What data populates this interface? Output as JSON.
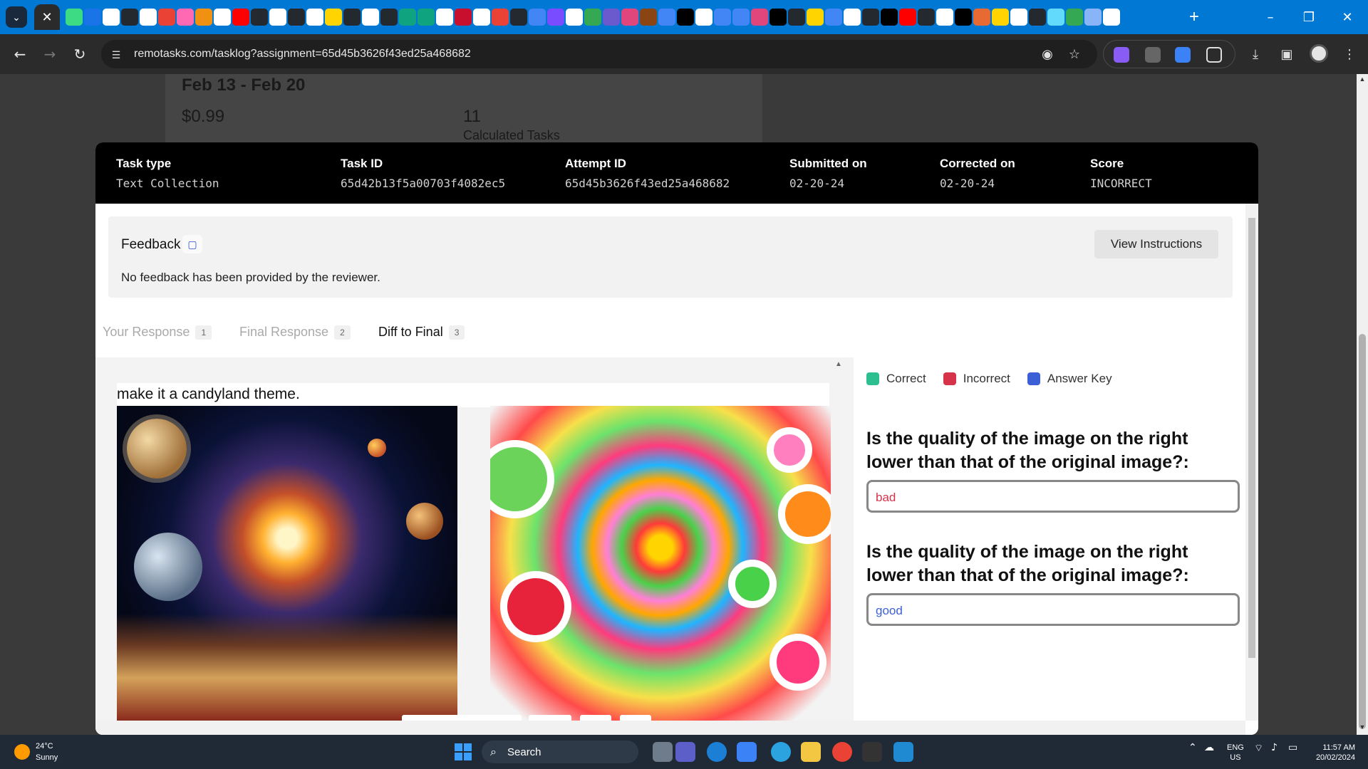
{
  "browser": {
    "tab_close_glyph": "✕",
    "tab_menu_glyph": "⌄",
    "new_tab_glyph": "+",
    "url": "remotasks.com/tasklog?assignment=65d45b3626f43ed25a468682",
    "window_controls": [
      "–",
      "❐",
      "✕"
    ]
  },
  "background_card": {
    "date_range": "Feb 13 - Feb 20",
    "amount": "$0.99",
    "task_count": "11",
    "task_count_label": "Calculated Tasks"
  },
  "modal": {
    "header": {
      "task_type_label": "Task type",
      "task_type": "Text Collection",
      "task_id_label": "Task ID",
      "task_id": "65d42b13f5a00703f4082ec5",
      "attempt_id_label": "Attempt ID",
      "attempt_id": "65d45b3626f43ed25a468682",
      "submitted_label": "Submitted on",
      "submitted": "02-20-24",
      "corrected_label": "Corrected on",
      "corrected": "02-20-24",
      "score_label": "Score",
      "score": "INCORRECT"
    },
    "feedback": {
      "title": "Feedback",
      "text": "No feedback has been provided by the reviewer.",
      "view_instructions": "View Instructions"
    },
    "tabs": [
      {
        "label": "Your Response",
        "count": "1"
      },
      {
        "label": "Final Response",
        "count": "2"
      },
      {
        "label": "Diff to Final",
        "count": "3"
      }
    ],
    "prompt": "make it a candyland theme.",
    "legend": [
      {
        "label": "Correct",
        "color": "#2ebf91"
      },
      {
        "label": "Incorrect",
        "color": "#d6334a"
      },
      {
        "label": "Answer Key",
        "color": "#3d5fd6"
      }
    ],
    "questions": [
      {
        "text": "Is the quality of the image on the right lower than that of the original image?:",
        "answer": "bad",
        "answer_color": "#d6334a"
      },
      {
        "text": "Is the quality of the image on the right lower than that of the original image?:",
        "answer": "good",
        "answer_color": "#3d5fd6"
      }
    ]
  },
  "taskbar": {
    "temperature": "24°C",
    "condition": "Sunny",
    "search_label": "Search",
    "lang_top": "ENG",
    "lang_bottom": "US",
    "time": "11:57 AM",
    "date": "20/02/2024"
  }
}
